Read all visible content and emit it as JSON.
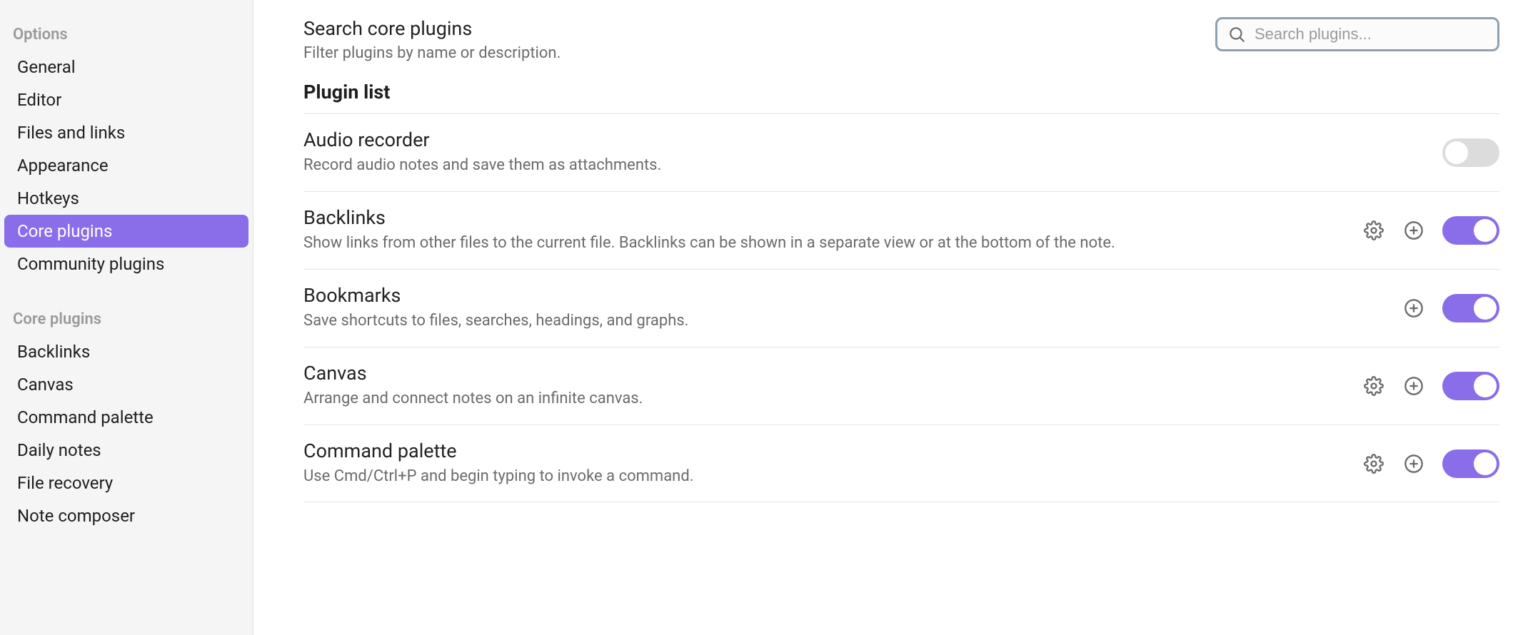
{
  "sidebar": {
    "sections": [
      {
        "header": "Options",
        "items": [
          {
            "label": "General",
            "active": false
          },
          {
            "label": "Editor",
            "active": false
          },
          {
            "label": "Files and links",
            "active": false
          },
          {
            "label": "Appearance",
            "active": false
          },
          {
            "label": "Hotkeys",
            "active": false
          },
          {
            "label": "Core plugins",
            "active": true
          },
          {
            "label": "Community plugins",
            "active": false
          }
        ]
      },
      {
        "header": "Core plugins",
        "items": [
          {
            "label": "Backlinks",
            "active": false
          },
          {
            "label": "Canvas",
            "active": false
          },
          {
            "label": "Command palette",
            "active": false
          },
          {
            "label": "Daily notes",
            "active": false
          },
          {
            "label": "File recovery",
            "active": false
          },
          {
            "label": "Note composer",
            "active": false
          }
        ]
      }
    ]
  },
  "search": {
    "title": "Search core plugins",
    "description": "Filter plugins by name or description.",
    "placeholder": "Search plugins..."
  },
  "plugin_list_heading": "Plugin list",
  "plugins": [
    {
      "name": "Audio recorder",
      "description": "Record audio notes and save them as attachments.",
      "has_settings": false,
      "has_hotkeys": false,
      "enabled": false
    },
    {
      "name": "Backlinks",
      "description": "Show links from other files to the current file. Backlinks can be shown in a separate view or at the bottom of the note.",
      "has_settings": true,
      "has_hotkeys": true,
      "enabled": true
    },
    {
      "name": "Bookmarks",
      "description": "Save shortcuts to files, searches, headings, and graphs.",
      "has_settings": false,
      "has_hotkeys": true,
      "enabled": true
    },
    {
      "name": "Canvas",
      "description": "Arrange and connect notes on an infinite canvas.",
      "has_settings": true,
      "has_hotkeys": true,
      "enabled": true
    },
    {
      "name": "Command palette",
      "description": "Use Cmd/Ctrl+P and begin typing to invoke a command.",
      "has_settings": true,
      "has_hotkeys": true,
      "enabled": true
    }
  ]
}
